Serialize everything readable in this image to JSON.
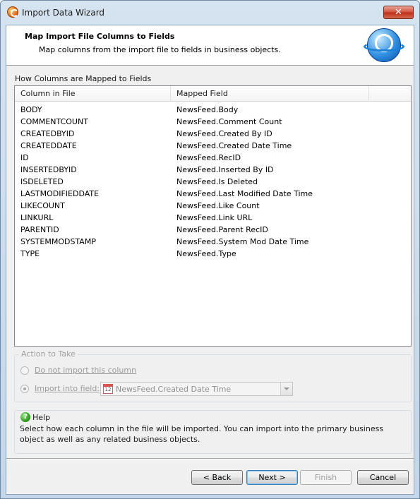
{
  "window": {
    "title": "Import Data Wizard",
    "close_label": "✕"
  },
  "header": {
    "title": "Map Import File Columns to Fields",
    "subtitle": "Map columns from the import file to fields in business objects."
  },
  "mapping": {
    "section_label": "How Columns are Mapped to Fields",
    "columns": [
      "Column in File",
      "Mapped Field"
    ],
    "rows": [
      {
        "column": "BODY",
        "field": "NewsFeed.Body"
      },
      {
        "column": "COMMENTCOUNT",
        "field": "NewsFeed.Comment Count"
      },
      {
        "column": "CREATEDBYID",
        "field": "NewsFeed.Created By ID"
      },
      {
        "column": "CREATEDDATE",
        "field": "NewsFeed.Created Date Time"
      },
      {
        "column": "ID",
        "field": "NewsFeed.RecID"
      },
      {
        "column": "INSERTEDBYID",
        "field": "NewsFeed.Inserted By ID"
      },
      {
        "column": "ISDELETED",
        "field": "NewsFeed.Is Deleted"
      },
      {
        "column": "LASTMODIFIEDDATE",
        "field": "NewsFeed.Last Modified Date Time"
      },
      {
        "column": "LIKECOUNT",
        "field": "NewsFeed.Like Count"
      },
      {
        "column": "LINKURL",
        "field": "NewsFeed.Link URL"
      },
      {
        "column": "PARENTID",
        "field": "NewsFeed.Parent RecID"
      },
      {
        "column": "SYSTEMMODSTAMP",
        "field": "NewsFeed.System Mod Date Time"
      },
      {
        "column": "TYPE",
        "field": "NewsFeed.Type"
      }
    ]
  },
  "action": {
    "legend": "Action to Take",
    "option_skip": "Do not import this column",
    "option_import": "Import into field:",
    "field_value": "NewsFeed.Created Date Time",
    "calendar_digit": "12"
  },
  "help": {
    "title": "Help",
    "icon_glyph": "?",
    "text": "Select how each column in the file will be imported. You can import into the primary business object as well as any related business objects."
  },
  "buttons": {
    "back": "< Back",
    "next": "Next >",
    "finish": "Finish",
    "cancel": "Cancel"
  }
}
